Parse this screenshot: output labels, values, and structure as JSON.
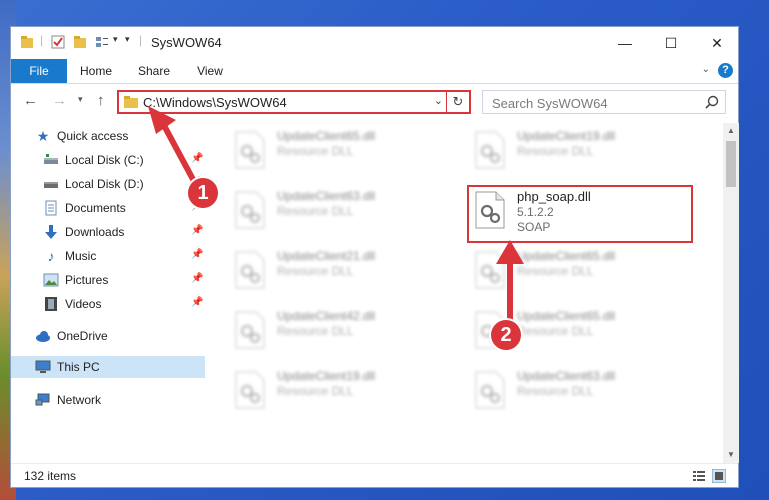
{
  "window": {
    "title": "SysWOW64",
    "controls": {
      "minimize": "—",
      "maximize": "☐",
      "close": "✕"
    }
  },
  "ribbon": {
    "tabs": [
      "File",
      "Home",
      "Share",
      "View"
    ],
    "help": "?"
  },
  "address_bar": {
    "path": "C:\\Windows\\SysWOW64",
    "search_placeholder": "Search SysWOW64"
  },
  "sidebar": {
    "items": [
      {
        "label": "Quick access",
        "icon": "star-icon",
        "pinned": false
      },
      {
        "label": "Local Disk (C:)",
        "icon": "drive-icon",
        "pinned": true
      },
      {
        "label": "Local Disk (D:)",
        "icon": "drive-icon",
        "pinned": true
      },
      {
        "label": "Documents",
        "icon": "documents-icon",
        "pinned": true
      },
      {
        "label": "Downloads",
        "icon": "download-icon",
        "pinned": true
      },
      {
        "label": "Music",
        "icon": "music-icon",
        "pinned": true
      },
      {
        "label": "Pictures",
        "icon": "pictures-icon",
        "pinned": true
      },
      {
        "label": "Videos",
        "icon": "videos-icon",
        "pinned": true
      },
      {
        "label": "OneDrive",
        "icon": "cloud-icon",
        "pinned": false
      },
      {
        "label": "This PC",
        "icon": "computer-icon",
        "pinned": false
      },
      {
        "label": "Network",
        "icon": "network-icon",
        "pinned": false
      }
    ]
  },
  "files": {
    "left_column": [
      {
        "name": "UpdateClient65.dll",
        "desc": "Resource DLL"
      },
      {
        "name": "UpdateClient63.dll",
        "desc": "Resource DLL"
      },
      {
        "name": "UpdateClient21.dll",
        "desc": "Resource DLL"
      },
      {
        "name": "UpdateClient42.dll",
        "desc": "Resource DLL"
      },
      {
        "name": "UpdateClient19.dll",
        "desc": "Resource DLL"
      }
    ],
    "right_column": [
      {
        "name": "UpdateClient19.dll",
        "desc": "Resource DLL"
      },
      {
        "name": "UpdateClient65.dll",
        "desc": "Resource DLL"
      },
      {
        "name": "UpdateClient65.dll",
        "desc": "Resource DLL"
      },
      {
        "name": "UpdateClient63.dll",
        "desc": "Resource DLL"
      }
    ],
    "highlighted": {
      "name": "php_soap.dll",
      "version": "5.1.2.2",
      "desc": "SOAP"
    }
  },
  "status": {
    "item_count": "132 items"
  },
  "annotations": {
    "step1": "1",
    "step2": "2",
    "color": "#d9353a"
  }
}
